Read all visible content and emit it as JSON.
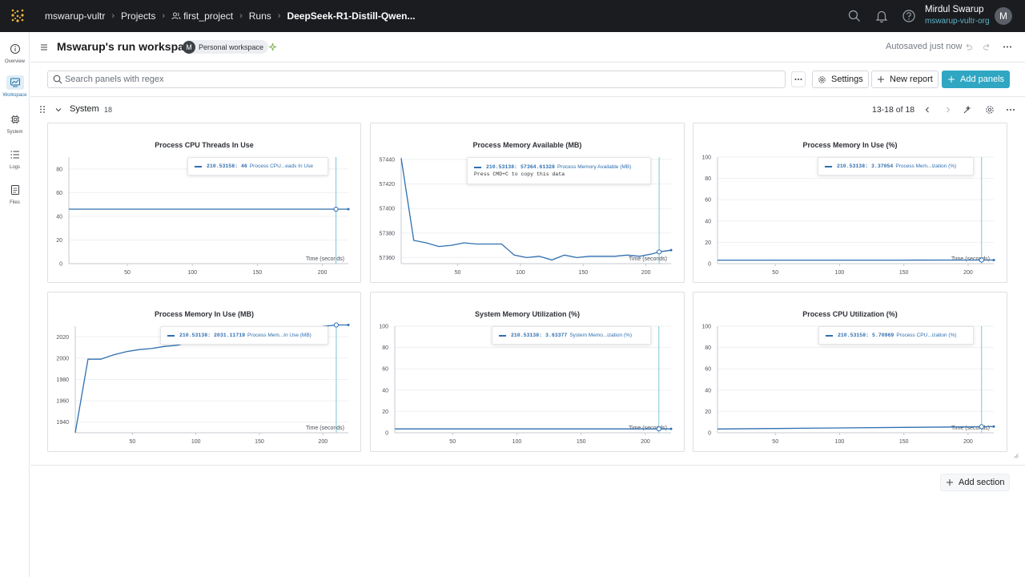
{
  "topbar": {
    "crumbs": [
      "mswarup-vultr",
      "Projects",
      "first_project",
      "Runs",
      "DeepSeek-R1-Distill-Qwen..."
    ],
    "user_name": "Mirdul Swarup",
    "user_org": "mswarup-vultr-org",
    "avatar_letter": "M",
    "icons": [
      "app-grid-icon",
      "search-icon",
      "bell-icon",
      "help-icon"
    ]
  },
  "leftrail": {
    "items": [
      {
        "label": "Overview",
        "icon": "info-icon"
      },
      {
        "label": "Workspace",
        "icon": "workspace-icon"
      },
      {
        "label": "System",
        "icon": "chip-icon"
      },
      {
        "label": "Logs",
        "icon": "list-icon"
      },
      {
        "label": "Files",
        "icon": "file-icon"
      }
    ]
  },
  "workspace": {
    "title": "Mswarup's run workspace",
    "badge_avatar": "M",
    "badge_text": "Personal workspace",
    "autosaved": "Autosaved just now"
  },
  "search": {
    "placeholder": "Search panels with regex",
    "settings_label": "Settings",
    "new_report_label": "New report",
    "add_panels_label": "Add panels"
  },
  "section": {
    "title": "System",
    "count": "18",
    "pager": "13-18 of 18",
    "add_section_label": "Add section"
  },
  "colors": {
    "series": "#2f6fb0",
    "accent": "#2fa6c2",
    "hover_line": "#7cc4d9"
  },
  "panels": [
    {
      "title": "Process CPU Threads In Use",
      "xlabel": "Time (seconds)",
      "xticks": [
        "50",
        "100",
        "150",
        "200"
      ],
      "yticks": [
        "0",
        "20",
        "40",
        "60",
        "80"
      ],
      "tooltip": {
        "x": "210.53158:",
        "value": "46",
        "name": "Process CPU...eads In Use"
      }
    },
    {
      "title": "Process Memory Available (MB)",
      "xlabel": "Time (seconds)",
      "xticks": [
        "50",
        "100",
        "150",
        "200"
      ],
      "yticks": [
        "57360",
        "57380",
        "57400",
        "57420",
        "57440"
      ],
      "tooltip": {
        "x": "210.53138:",
        "value": "57364.61328",
        "name": "Process Memory Available (MB)",
        "hint": "Press CMD+C to copy this data"
      }
    },
    {
      "title": "Process Memory In Use (%)",
      "xlabel": "Time (seconds)",
      "xticks": [
        "50",
        "100",
        "150",
        "200"
      ],
      "yticks": [
        "0",
        "20",
        "40",
        "60",
        "80",
        "100"
      ],
      "tooltip": {
        "x": "210.53138:",
        "value": "3.37054",
        "name": "Process Mem...ization (%)"
      }
    },
    {
      "title": "Process Memory In Use (MB)",
      "xlabel": "Time (seconds)",
      "xticks": [
        "50",
        "100",
        "150",
        "200"
      ],
      "yticks": [
        "1940",
        "1960",
        "1980",
        "2000",
        "2020"
      ],
      "tooltip": {
        "x": "210.53138:",
        "value": "2031.11719",
        "name": "Process Mem...In Use (MB)"
      }
    },
    {
      "title": "System Memory Utilization (%)",
      "xlabel": "Time (seconds)",
      "xticks": [
        "50",
        "100",
        "150",
        "200"
      ],
      "yticks": [
        "0",
        "20",
        "40",
        "60",
        "80",
        "100"
      ],
      "tooltip": {
        "x": "210.53138:",
        "value": "3.63377",
        "name": "System Memo...ization (%)"
      }
    },
    {
      "title": "Process CPU Utilization (%)",
      "xlabel": "Time (seconds)",
      "xticks": [
        "50",
        "100",
        "150",
        "200"
      ],
      "yticks": [
        "0",
        "20",
        "40",
        "60",
        "80",
        "100"
      ],
      "tooltip": {
        "x": "210.53158:",
        "value": "5.70969",
        "name": "Process CPU...ization (%)"
      }
    }
  ],
  "chart_data": [
    {
      "type": "line",
      "title": "Process CPU Threads In Use",
      "xlabel": "Time (seconds)",
      "ylabel": "",
      "xlim": [
        5,
        220
      ],
      "ylim": [
        0,
        90
      ],
      "series": [
        {
          "name": "Process CPU Threads In Use",
          "x": [
            5,
            50,
            100,
            150,
            200,
            210.5,
            220
          ],
          "y": [
            46,
            46,
            46,
            46,
            46,
            46,
            46
          ]
        }
      ]
    },
    {
      "type": "line",
      "title": "Process Memory Available (MB)",
      "xlabel": "Time (seconds)",
      "ylabel": "",
      "xlim": [
        5,
        220
      ],
      "ylim": [
        57355,
        57442
      ],
      "series": [
        {
          "name": "Process Memory Available (MB)",
          "x": [
            5,
            15,
            25,
            35,
            45,
            55,
            65,
            75,
            85,
            95,
            105,
            115,
            125,
            135,
            145,
            155,
            165,
            175,
            185,
            195,
            205,
            210.5,
            220
          ],
          "y": [
            57441,
            57374,
            57372,
            57369,
            57370,
            57372,
            57371,
            57371,
            57371,
            57362,
            57360,
            57361,
            57358,
            57362,
            57360,
            57361,
            57361,
            57361,
            57362,
            57361,
            57363,
            57364.6,
            57366
          ]
        }
      ]
    },
    {
      "type": "line",
      "title": "Process Memory In Use (%)",
      "xlabel": "Time (seconds)",
      "ylabel": "",
      "xlim": [
        5,
        220
      ],
      "ylim": [
        0,
        100
      ],
      "series": [
        {
          "name": "Process Memory In Use (%)",
          "x": [
            5,
            50,
            100,
            150,
            200,
            210.5,
            220
          ],
          "y": [
            3.3,
            3.3,
            3.3,
            3.3,
            3.35,
            3.37,
            3.37
          ]
        }
      ]
    },
    {
      "type": "line",
      "title": "Process Memory In Use (MB)",
      "xlabel": "Time (seconds)",
      "ylabel": "",
      "xlim": [
        5,
        220
      ],
      "ylim": [
        1930,
        2030
      ],
      "series": [
        {
          "name": "Process Memory In Use (MB)",
          "x": [
            5,
            15,
            25,
            35,
            45,
            55,
            65,
            75,
            85,
            95,
            210.5,
            220
          ],
          "y": [
            1930,
            1999,
            1999,
            2003,
            2006,
            2008,
            2009,
            2011,
            2012,
            2015,
            2031.1,
            2031.1
          ]
        }
      ]
    },
    {
      "type": "line",
      "title": "System Memory Utilization (%)",
      "xlabel": "Time (seconds)",
      "ylabel": "",
      "xlim": [
        5,
        220
      ],
      "ylim": [
        0,
        100
      ],
      "series": [
        {
          "name": "System Memory Utilization (%)",
          "x": [
            5,
            50,
            100,
            150,
            200,
            210.5,
            220
          ],
          "y": [
            3.6,
            3.6,
            3.6,
            3.6,
            3.63,
            3.63,
            3.63
          ]
        }
      ]
    },
    {
      "type": "line",
      "title": "Process CPU Utilization (%)",
      "xlabel": "Time (seconds)",
      "ylabel": "",
      "xlim": [
        5,
        220
      ],
      "ylim": [
        0,
        100
      ],
      "series": [
        {
          "name": "Process CPU Utilization (%)",
          "x": [
            5,
            50,
            100,
            150,
            200,
            210.5,
            220
          ],
          "y": [
            3.5,
            4,
            4.5,
            5,
            5.5,
            5.71,
            5.8
          ]
        }
      ]
    }
  ]
}
